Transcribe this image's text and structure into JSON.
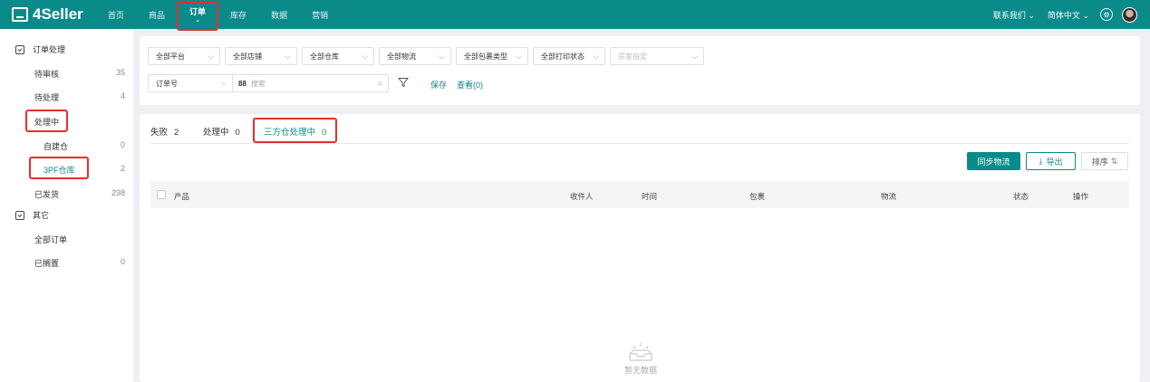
{
  "brand": {
    "name": "4Seller"
  },
  "nav": {
    "items": [
      "首页",
      "商品",
      "订单",
      "库存",
      "数据",
      "营销"
    ],
    "active_index": 2,
    "active_caret": "⌄"
  },
  "topright": {
    "contact": "联系我们",
    "language": "简体中文",
    "chevron": "⌄",
    "gear_glyph": "⚙"
  },
  "sidebar": {
    "group1": "订单处理",
    "items": [
      {
        "label": "待审核",
        "count": "35"
      },
      {
        "label": "待处理",
        "count": "4"
      },
      {
        "label": "处理中",
        "count": ""
      },
      {
        "label": "自建仓",
        "count": "0"
      },
      {
        "label": "3PF仓库",
        "count": "2"
      },
      {
        "label": "已发货",
        "count": "298"
      }
    ],
    "group2": "其它",
    "items2": [
      {
        "label": "全部订单",
        "count": ""
      },
      {
        "label": "已搁置",
        "count": "0"
      }
    ]
  },
  "filters": {
    "selects": [
      "全部平台",
      "全部店铺",
      "全部仓库",
      "全部物流",
      "全部包裹类型",
      "全部打印状态"
    ],
    "buyer_placeholder": "买家指定",
    "order_field": "订单号",
    "search_prefix": "88",
    "search_placeholder": "搜索",
    "save": "保存",
    "view": "查看(0)",
    "chevron": "⌵",
    "magnifier": "⌕"
  },
  "tabs": [
    {
      "label": "失败",
      "count": "2"
    },
    {
      "label": "处理中",
      "count": "0"
    },
    {
      "label": "三方仓处理中",
      "count": "0"
    }
  ],
  "active_tab": 2,
  "actions": {
    "sync": "同步物流",
    "export": "导出",
    "export_icon": "⤓",
    "sort": "排序",
    "sort_icon": "⇅"
  },
  "table": {
    "columns": [
      "产品",
      "收件人",
      "时间",
      "包裹",
      "物流",
      "状态",
      "操作"
    ]
  },
  "empty_text": "暂无数据",
  "colors": {
    "brand": "#0b8a8a",
    "highlight": "#e52f2f"
  }
}
